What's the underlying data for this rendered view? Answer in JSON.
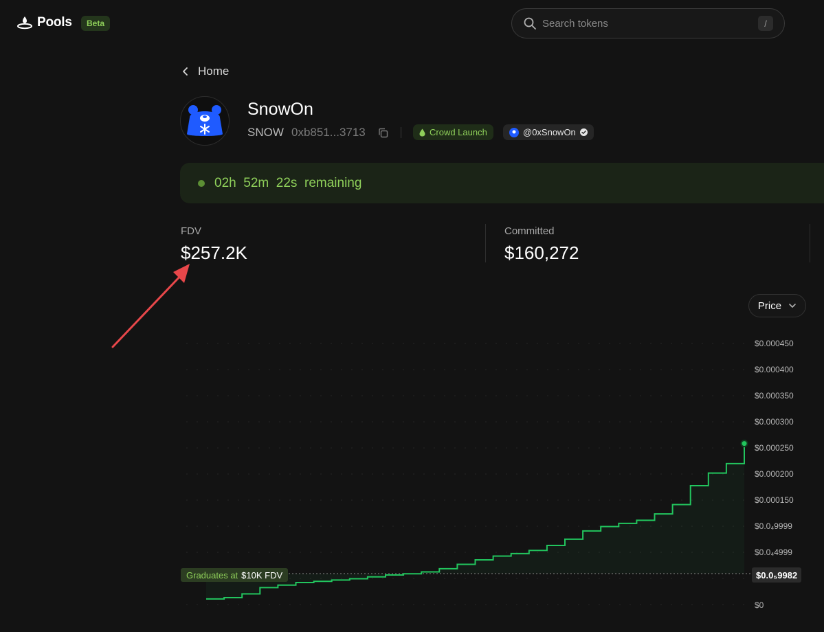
{
  "header": {
    "logo_text": "Pools",
    "beta_label": "Beta",
    "search_placeholder": "Search tokens",
    "search_shortcut": "/"
  },
  "breadcrumb": {
    "back_label": "Home"
  },
  "token": {
    "name": "SnowOn",
    "symbol": "SNOW",
    "address": "0xb851...3713",
    "badge_launch": "Crowd Launch",
    "twitter_handle": "@0xSnowOn",
    "avatar_icon": "bear-snowflake-logo"
  },
  "countdown": {
    "hours": "02h",
    "minutes": "52m",
    "seconds": "22s",
    "suffix": "remaining"
  },
  "stats": {
    "fdv_label": "FDV",
    "fdv_value": "$257.2K",
    "committed_label": "Committed",
    "committed_value": "$160,272"
  },
  "chart_controls": {
    "metric_label": "Price"
  },
  "chart_data": {
    "type": "line",
    "y_tick_labels": [
      "$0.000450",
      "$0.000400",
      "$0.000350",
      "$0.000300",
      "$0.000250",
      "$0.000200",
      "$0.000150",
      "$0.0₄9999",
      "$0.0₄4999",
      "$0"
    ],
    "graduation_label_prefix": "Graduates at",
    "graduation_label_value": "$10K FDV",
    "current_price_label": "$0.0₅9982",
    "series": [
      {
        "values": [
          1e-05,
          1.2e-05,
          1.8e-05,
          2.8e-05,
          3.2e-05,
          3.6e-05,
          3.8e-05,
          4e-05,
          4.2e-05,
          4.5e-05,
          4.8e-05,
          5e-05,
          5.3e-05,
          5.8e-05,
          6.5e-05,
          7.2e-05,
          7.8e-05,
          8.2e-05,
          8.7e-05,
          9.5e-05,
          0.000105,
          0.000118,
          0.000125,
          0.00013,
          0.000135,
          0.000145,
          0.00016,
          0.00019,
          0.00021,
          0.000225,
          0.000257
        ]
      }
    ],
    "colors": {
      "line": "#22c55e",
      "grid": "#2a2a2a"
    }
  },
  "colors": {
    "accent_green": "#8fd05a",
    "line_green": "#22c55e",
    "annotation_red": "#e8474a",
    "background": "#131313"
  }
}
